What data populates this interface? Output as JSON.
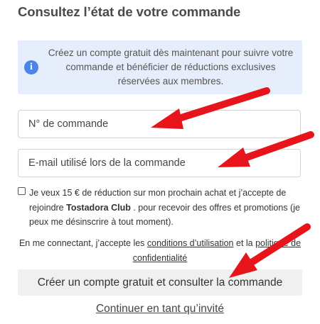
{
  "page": {
    "title": "Consultez l’état de votre commande"
  },
  "info": {
    "icon": "info-icon",
    "icon_glyph": "i",
    "text": "Créez un compte gratuit dès maintenant pour suivre votre commande et bénéficier de réductions exclusives réservées aux membres."
  },
  "form": {
    "order_placeholder": "N° de commande",
    "email_placeholder": "E-mail utilisé lors de la commande",
    "consent_before": "Je veux 15 € de réduction sur mon prochain achat et j’accepte de rejoindre ",
    "consent_club": "Tostadora Club",
    "consent_after": " . pour recevoir des offres et promotions (je peux me désinscrire à tout moment).",
    "consent_checked": false,
    "terms_before": "En me connectant, j’accepte les ",
    "terms_link": "conditions d’utilisation",
    "terms_middle": " et la ",
    "privacy_link": "politique de confidentialité",
    "submit_label": "Créer un compte gratuit et consulter la commande",
    "guest_link": "Continuer en tant qu’invité"
  },
  "colors": {
    "info_bg": "#e6eefc",
    "info_icon": "#4a86e8",
    "arrow": "#e8141c",
    "button_bg": "#f0f0f0"
  }
}
